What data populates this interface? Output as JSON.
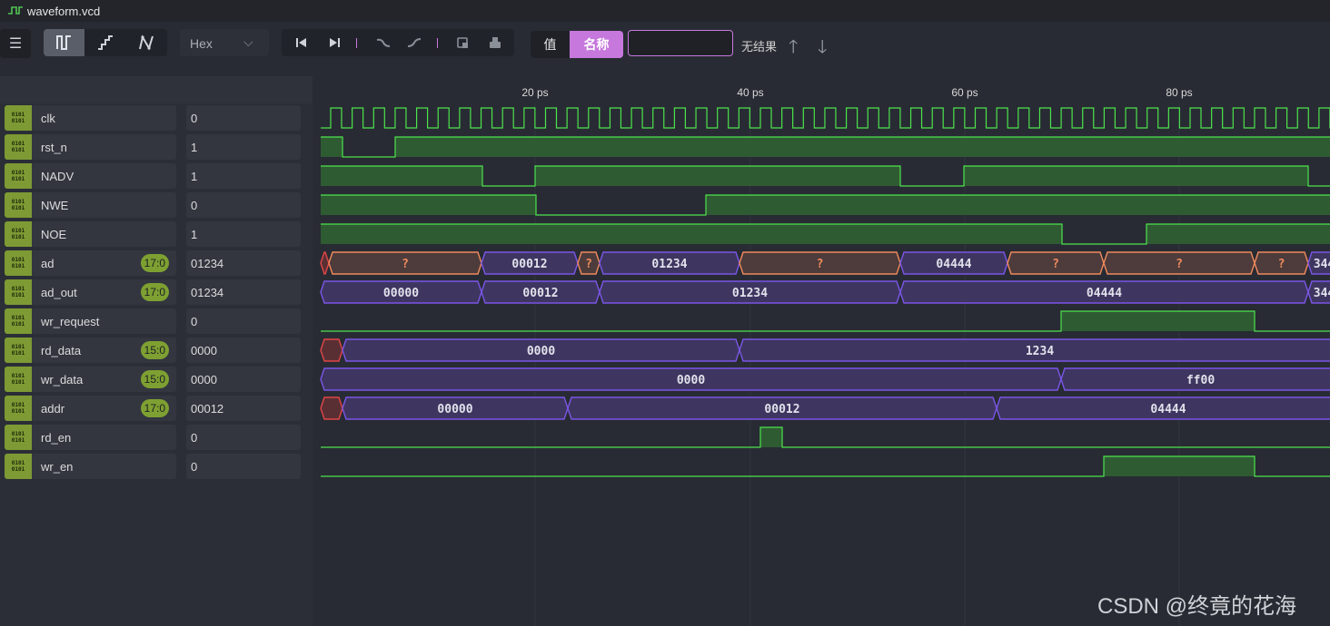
{
  "window": {
    "title": "waveform.vcd"
  },
  "toolbar": {
    "menu_icon": "hamburger-icon",
    "modes": [
      "digital-square-icon",
      "step-icon",
      "analog-line-icon"
    ],
    "format_select": "Hex",
    "nav_icons": [
      "jump-start-icon",
      "jump-end-icon",
      "prev-edge-icon",
      "next-edge-icon",
      "snapshot-icon",
      "print-icon"
    ],
    "toggle_value": "值",
    "toggle_name": "名称",
    "search_value": "",
    "search_status": "无结果"
  },
  "timeline": {
    "ticks": [
      "20 ps",
      "40 ps",
      "60 ps",
      "80 ps"
    ]
  },
  "signals": [
    {
      "name": "clk",
      "value": "0",
      "range": ""
    },
    {
      "name": "rst_n",
      "value": "1",
      "range": ""
    },
    {
      "name": "NADV",
      "value": "1",
      "range": ""
    },
    {
      "name": "NWE",
      "value": "0",
      "range": ""
    },
    {
      "name": "NOE",
      "value": "1",
      "range": ""
    },
    {
      "name": "ad",
      "value": "01234",
      "range": "17:0"
    },
    {
      "name": "ad_out",
      "value": "01234",
      "range": "17:0"
    },
    {
      "name": "wr_request",
      "value": "0",
      "range": ""
    },
    {
      "name": "rd_data",
      "value": "0000",
      "range": "15:0"
    },
    {
      "name": "wr_data",
      "value": "0000",
      "range": "15:0"
    },
    {
      "name": "addr",
      "value": "00012",
      "range": "17:0"
    },
    {
      "name": "rd_en",
      "value": "0",
      "range": ""
    },
    {
      "name": "wr_en",
      "value": "0",
      "range": ""
    }
  ],
  "bus_labels": {
    "ad": [
      "?",
      "00012",
      "?",
      "01234",
      "?",
      "04444",
      "?",
      "?",
      "?",
      "344"
    ],
    "ad_out": [
      "00000",
      "00012",
      "01234",
      "04444",
      "344"
    ],
    "rd_data": [
      "0000",
      "1234"
    ],
    "wr_data": [
      "0000",
      "ff00"
    ],
    "addr": [
      "00000",
      "00012",
      "04444"
    ]
  },
  "colors": {
    "accent": "#c678dd",
    "wave_high_fill": "#2f5b33",
    "wave_line": "#4de34d",
    "bus_fill": "#3e3660",
    "bus_edge": "#7a55e6",
    "unknown_fill": "#4d3c3b",
    "unknown_edge": "#f08a5d",
    "badge": "#7ea032"
  },
  "watermark": "CSDN @终竟的花海"
}
